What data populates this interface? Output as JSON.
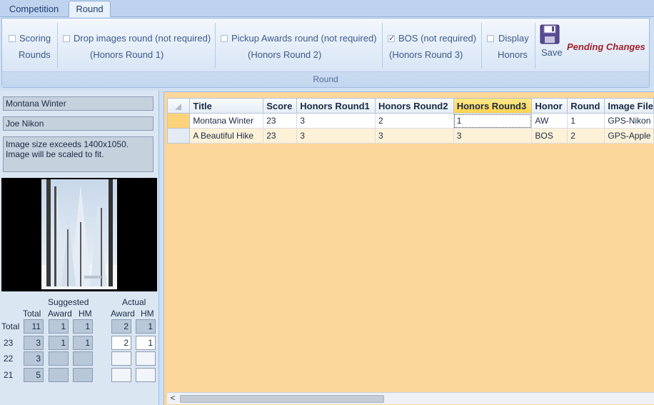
{
  "tabs": [
    {
      "label": "Competition",
      "active": false
    },
    {
      "label": "Round",
      "active": true
    }
  ],
  "ribbon": {
    "group_label": "Round",
    "scoring_rounds": {
      "line1": "Scoring",
      "line2": "Rounds",
      "checked": false
    },
    "drop_images": {
      "line1": "Drop images round (not required)",
      "line2": "(Honors Round 1)",
      "checked": false
    },
    "pickup_awards": {
      "line1": "Pickup Awards round (not required)",
      "line2": "(Honors Round 2)",
      "checked": false
    },
    "bos": {
      "line1": "BOS (not required)",
      "line2": "(Honors Round 3)",
      "checked": true
    },
    "display_honors": {
      "line1": "Display",
      "line2": "Honors",
      "checked": false
    },
    "save_label": "Save",
    "pending_label": "Pending Changes"
  },
  "image_info": {
    "title": "Montana Winter",
    "maker": "Joe Nikon",
    "message": "Image size exceeds 1400x1050. Image will be scaled to fit."
  },
  "stats": {
    "suggested_label": "Suggested",
    "actual_label": "Actual",
    "col_total": "Total",
    "col_award": "Award",
    "col_hm": "HM",
    "rows": [
      {
        "label": "Total",
        "total": "11",
        "s_award": "1",
        "s_hm": "1",
        "a_award": "2",
        "a_hm": "1"
      },
      {
        "label": "23",
        "total": "3",
        "s_award": "1",
        "s_hm": "1",
        "a_award": "2",
        "a_hm": "1"
      },
      {
        "label": "22",
        "total": "3",
        "s_award": "",
        "s_hm": "",
        "a_award": "",
        "a_hm": ""
      },
      {
        "label": "21",
        "total": "5",
        "s_award": "",
        "s_hm": "",
        "a_award": "",
        "a_hm": ""
      }
    ]
  },
  "grid": {
    "columns": [
      "Title",
      "Score",
      "Honors Round1",
      "Honors Round2",
      "Honors Round3",
      "Honor",
      "Round",
      "Image File"
    ],
    "rows": [
      [
        "Montana Winter",
        "23",
        "3",
        "2",
        "1",
        "AW",
        "1",
        "GPS-Nikon"
      ],
      [
        "A Beautiful Hike",
        "23",
        "3",
        "3",
        "3",
        "BOS",
        "2",
        "GPS-Apple"
      ]
    ],
    "scroll_left": "<"
  },
  "colors": {
    "accent_pending": "#a31f26",
    "grid_background": "#fcd79b",
    "selected_header": "#ffd34d"
  }
}
